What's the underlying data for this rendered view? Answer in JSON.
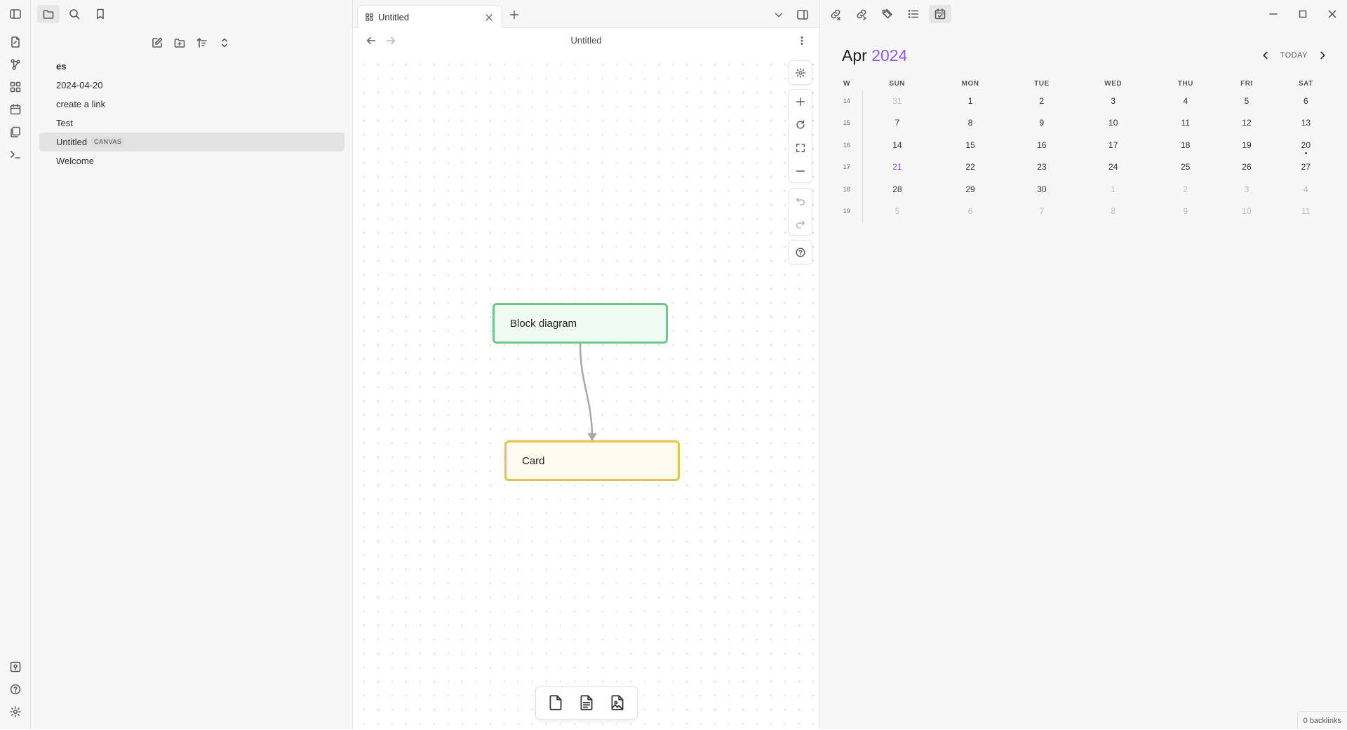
{
  "ribbon": {
    "top_icons": [
      "new-note-icon",
      "graph-view-icon",
      "canvas-icon",
      "daily-note-icon",
      "templates-icon",
      "command-palette-icon"
    ],
    "bottom_icons": [
      "vault-switcher-icon",
      "help-icon",
      "settings-icon"
    ]
  },
  "left_sidebar": {
    "tabs": [
      "files-tab",
      "search-tab",
      "bookmarks-tab"
    ],
    "actions": [
      "new-note",
      "new-folder",
      "sort",
      "collapse"
    ],
    "vault_name": "es",
    "files": [
      {
        "label": "2024-04-20"
      },
      {
        "label": "create a link"
      },
      {
        "label": "Test"
      },
      {
        "label": "Untitled",
        "tag": "CANVAS",
        "active": true
      },
      {
        "label": "Welcome"
      }
    ]
  },
  "editor": {
    "tab_title": "Untitled",
    "view_title": "Untitled",
    "nodes": {
      "block": "Block diagram",
      "card": "Card"
    },
    "node_colors": {
      "block_border": "#6cc98a",
      "card_border": "#e5c34e"
    },
    "controls": [
      "settings",
      "zoom-in",
      "reset-zoom",
      "zoom-to-fit",
      "zoom-out",
      "undo",
      "redo",
      "help"
    ],
    "toolbar": [
      "add-card",
      "add-note",
      "add-media"
    ]
  },
  "calendar": {
    "month": "Apr",
    "year": "2024",
    "today_label": "TODAY",
    "headers": [
      "W",
      "SUN",
      "MON",
      "TUE",
      "WED",
      "THU",
      "FRI",
      "SAT"
    ],
    "weeks": [
      {
        "w": "14",
        "days": [
          "31",
          "1",
          "2",
          "3",
          "4",
          "5",
          "6"
        ]
      },
      {
        "w": "15",
        "days": [
          "7",
          "8",
          "9",
          "10",
          "11",
          "12",
          "13"
        ]
      },
      {
        "w": "16",
        "days": [
          "14",
          "15",
          "16",
          "17",
          "18",
          "19",
          "20"
        ]
      },
      {
        "w": "17",
        "days": [
          "21",
          "22",
          "23",
          "24",
          "25",
          "26",
          "27"
        ]
      },
      {
        "w": "18",
        "days": [
          "28",
          "29",
          "30",
          "1",
          "2",
          "3",
          "4"
        ]
      },
      {
        "w": "19",
        "days": [
          "5",
          "6",
          "7",
          "8",
          "9",
          "10",
          "11"
        ]
      }
    ],
    "accent_color": "#8a5cf5"
  },
  "status": {
    "backlinks": "0 backlinks"
  }
}
